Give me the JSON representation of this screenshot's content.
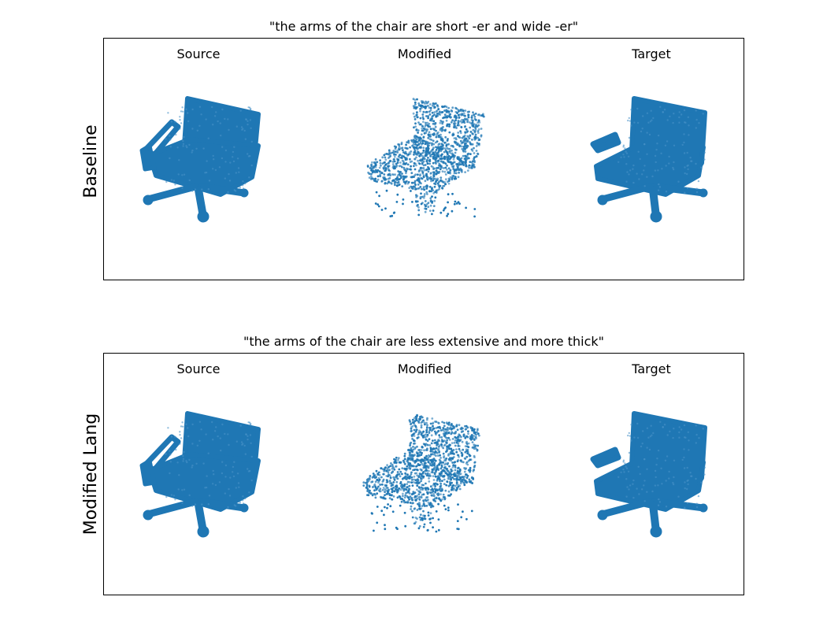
{
  "rows": [
    {
      "row_label": "Baseline",
      "title": "\"the arms of the chair are short -er and wide -er\"",
      "columns": [
        "Source",
        "Modified",
        "Target"
      ]
    },
    {
      "row_label": "Modified Lang",
      "title": "\"the arms of the chair are less extensive and more thick\"",
      "columns": [
        "Source",
        "Modified",
        "Target"
      ]
    }
  ],
  "colors": {
    "points": "#1f77b4",
    "border": "#000000"
  }
}
